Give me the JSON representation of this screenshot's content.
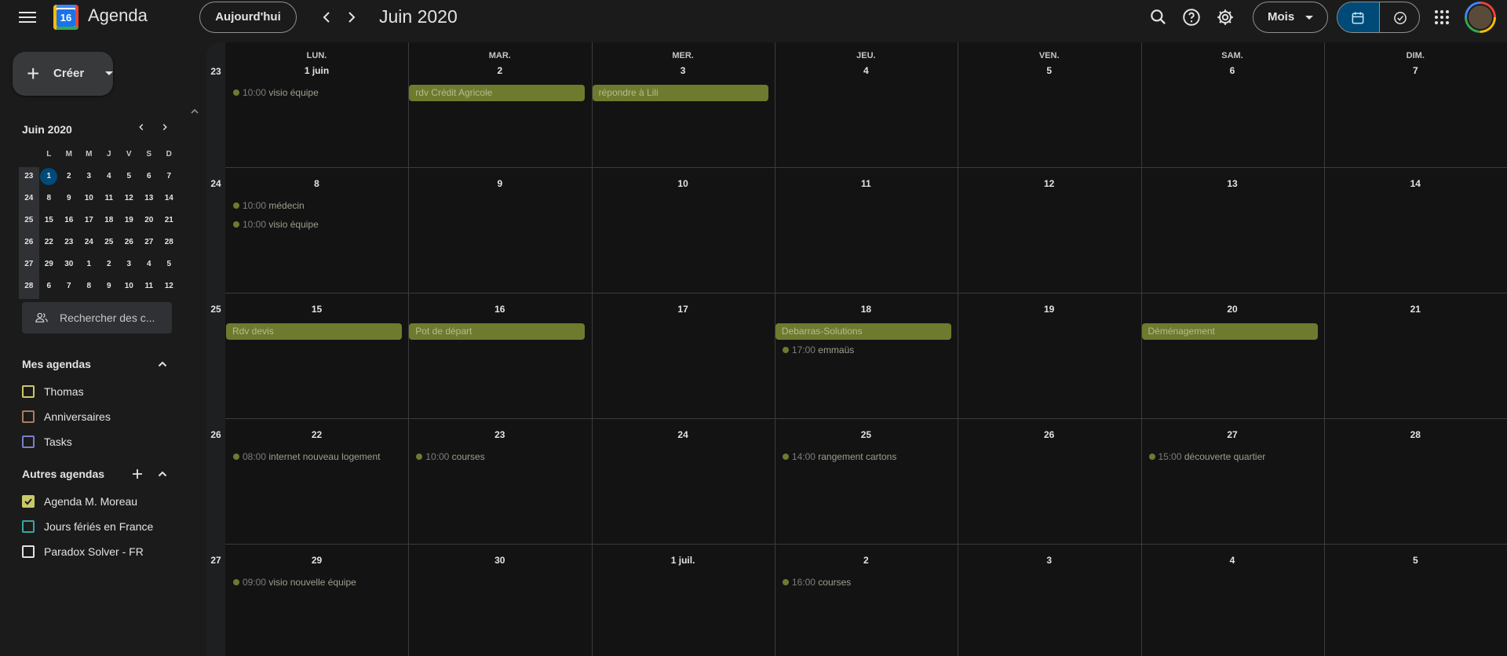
{
  "header": {
    "app_name": "Agenda",
    "logo_day": "16",
    "today": "Aujourd'hui",
    "period": "Juin 2020",
    "view": "Mois"
  },
  "sidebar": {
    "create": "Créer",
    "mini_title": "Juin 2020",
    "mini_days": [
      "L",
      "M",
      "M",
      "J",
      "V",
      "S",
      "D"
    ],
    "mini_rows": [
      [
        "23",
        "1",
        "2",
        "3",
        "4",
        "5",
        "6",
        "7"
      ],
      [
        "24",
        "8",
        "9",
        "10",
        "11",
        "12",
        "13",
        "14"
      ],
      [
        "25",
        "15",
        "16",
        "17",
        "18",
        "19",
        "20",
        "21"
      ],
      [
        "26",
        "22",
        "23",
        "24",
        "25",
        "26",
        "27",
        "28"
      ],
      [
        "27",
        "29",
        "30",
        "1",
        "2",
        "3",
        "4",
        "5"
      ],
      [
        "28",
        "6",
        "7",
        "8",
        "9",
        "10",
        "11",
        "12"
      ]
    ],
    "search_people": "Rechercher des c...",
    "my_calendars_title": "Mes agendas",
    "my_calendars": [
      {
        "name": "Thomas",
        "color": "#c9c96a",
        "checked": false
      },
      {
        "name": "Anniversaires",
        "color": "#b07a5e",
        "checked": false
      },
      {
        "name": "Tasks",
        "color": "#7b7fd0",
        "checked": false
      }
    ],
    "other_calendars_title": "Autres agendas",
    "other_calendars": [
      {
        "name": "Agenda M. Moreau",
        "color": "#c9c96a",
        "checked": true
      },
      {
        "name": "Jours fériés en France",
        "color": "#3aa6a0",
        "checked": false
      },
      {
        "name": "Paradox Solver - FR",
        "color": "#e3e3e3",
        "checked": false
      }
    ]
  },
  "grid": {
    "day_headers": [
      "LUN.",
      "MAR.",
      "MER.",
      "JEU.",
      "VEN.",
      "SAM.",
      "DIM."
    ],
    "week_numbers": [
      "23",
      "24",
      "25",
      "26",
      "27"
    ],
    "weeks": [
      [
        "1 juin",
        "2",
        "3",
        "4",
        "5",
        "6",
        "7"
      ],
      [
        "8",
        "9",
        "10",
        "11",
        "12",
        "13",
        "14"
      ],
      [
        "15",
        "16",
        "17",
        "18",
        "19",
        "20",
        "21"
      ],
      [
        "22",
        "23",
        "24",
        "25",
        "26",
        "27",
        "28"
      ],
      [
        "29",
        "30",
        "1 juil.",
        "2",
        "3",
        "4",
        "5"
      ]
    ],
    "bar_events": [
      {
        "week": 0,
        "day": 1,
        "title": "rdv Crédit Agricole"
      },
      {
        "week": 0,
        "day": 2,
        "title": "répondre à Lili"
      },
      {
        "week": 2,
        "day": 0,
        "title": "Rdv devis"
      },
      {
        "week": 2,
        "day": 1,
        "title": "Pot de départ"
      },
      {
        "week": 2,
        "day": 3,
        "title": "Debarras-Solutions"
      },
      {
        "week": 2,
        "day": 5,
        "title": "Déménagement"
      }
    ],
    "timed_events": [
      {
        "week": 0,
        "day": 0,
        "slot": 0,
        "time": "10:00",
        "title": "visio équipe"
      },
      {
        "week": 1,
        "day": 0,
        "slot": 0,
        "time": "10:00",
        "title": "médecin"
      },
      {
        "week": 1,
        "day": 0,
        "slot": 1,
        "time": "10:00",
        "title": "visio équipe"
      },
      {
        "week": 2,
        "day": 3,
        "slot": 1,
        "time": "17:00",
        "title": "emmaüs"
      },
      {
        "week": 3,
        "day": 0,
        "slot": 0,
        "time": "08:00",
        "title": "internet nouveau logement"
      },
      {
        "week": 3,
        "day": 1,
        "slot": 0,
        "time": "10:00",
        "title": "courses"
      },
      {
        "week": 3,
        "day": 3,
        "slot": 0,
        "time": "14:00",
        "title": "rangement cartons"
      },
      {
        "week": 3,
        "day": 5,
        "slot": 0,
        "time": "15:00",
        "title": "découverte quartier"
      },
      {
        "week": 4,
        "day": 0,
        "slot": 0,
        "time": "09:00",
        "title": "visio nouvelle équipe"
      },
      {
        "week": 4,
        "day": 3,
        "slot": 0,
        "time": "16:00",
        "title": "courses"
      }
    ]
  }
}
